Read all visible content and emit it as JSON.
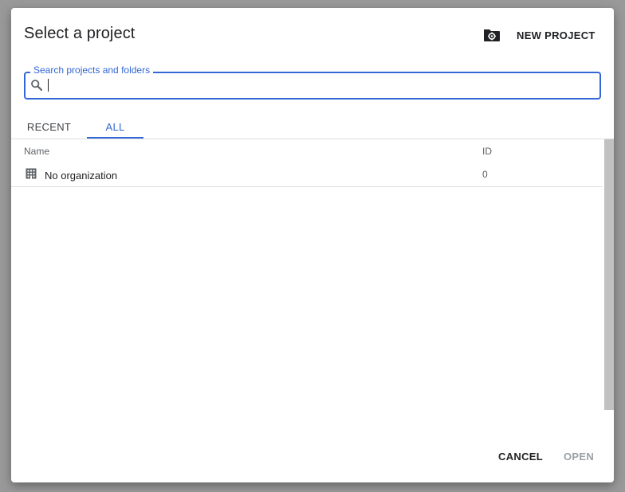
{
  "dialog": {
    "title": "Select a project",
    "new_project_label": "NEW PROJECT",
    "search": {
      "legend": "Search projects and folders",
      "value": "",
      "placeholder": ""
    },
    "tabs": [
      {
        "label": "RECENT",
        "active": false
      },
      {
        "label": "ALL",
        "active": true
      }
    ],
    "table": {
      "headers": {
        "name": "Name",
        "id": "ID"
      },
      "rows": [
        {
          "name": "No organization",
          "id": "0",
          "icon": "building-icon"
        }
      ]
    },
    "buttons": {
      "cancel": "CANCEL",
      "open": "OPEN"
    }
  },
  "colors": {
    "accent": "#3367d6",
    "backdrop": "#999999",
    "text": "#202124",
    "disabled": "#9aa0a6"
  },
  "icons": {
    "new_project": "folder-gear-icon",
    "search": "search-icon",
    "organization": "building-icon"
  }
}
